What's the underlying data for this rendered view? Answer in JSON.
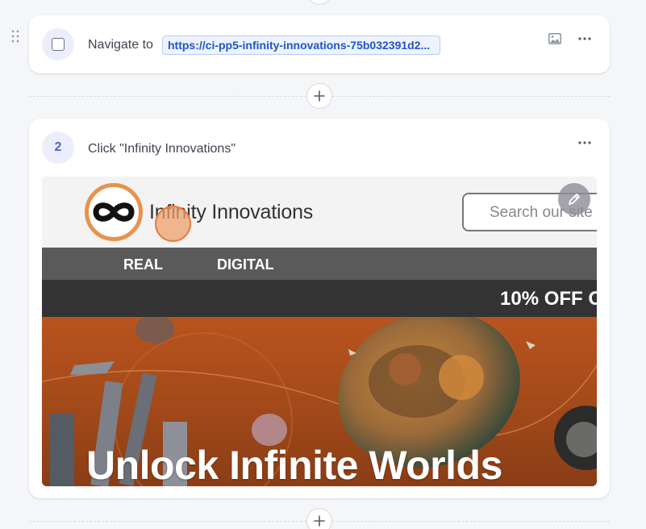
{
  "steps": [
    {
      "action_label": "Navigate to",
      "url": "https://ci-pp5-infinity-innovations-75b032391d2..."
    },
    {
      "number": "2",
      "action_label": "Click \"Infinity Innovations\""
    }
  ],
  "preview": {
    "site_name": "Infinity Innovations",
    "search_placeholder": "Search our site",
    "nav": [
      "REAL",
      "DIGITAL"
    ],
    "promo": "10% OFF O",
    "hero_title": "Unlock Infinite Worlds"
  },
  "icons": {
    "drag": "drag-handle-icon",
    "image": "image-icon",
    "more": "more-horizontal-icon",
    "add": "plus-icon",
    "edit": "pencil-icon",
    "logo": "infinity-icon"
  },
  "colors": {
    "accent": "#4f5fd6",
    "link": "#1f55c9",
    "click_marker": "#e87c3c"
  }
}
